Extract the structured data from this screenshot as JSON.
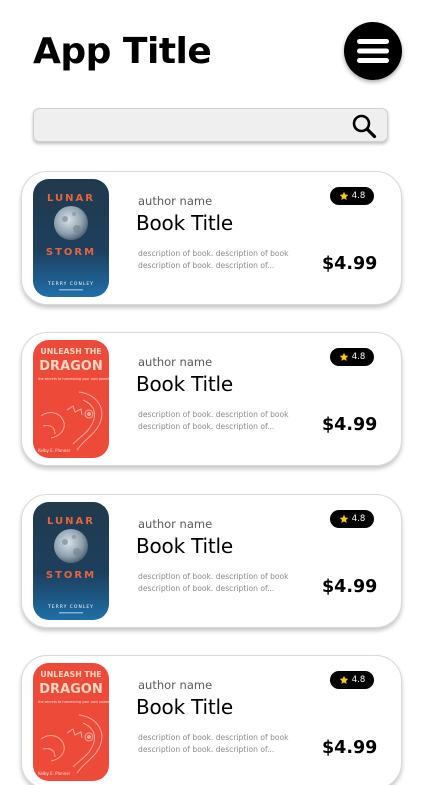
{
  "header": {
    "title": "App Title",
    "menu_icon": "hamburger-menu-icon"
  },
  "search": {
    "placeholder": "",
    "value": "",
    "icon": "search-icon"
  },
  "colors": {
    "badge": "#000000",
    "star": "#f5c518",
    "moon_cover": "#1e3b52",
    "dragon_cover": "#ee4a3a",
    "dragon_title": "#f5d9c2"
  },
  "books": [
    {
      "cover": {
        "style": "moon",
        "title_top": "LUNAR",
        "title_bottom": "STORM",
        "author": "TERRY CONLEY"
      },
      "author": "author name",
      "title": "Book Title",
      "description": "description of book. description of book description of book. description of...",
      "rating": "4.8",
      "price": "$4.99"
    },
    {
      "cover": {
        "style": "dragon",
        "title_top": "UNLEASH THE",
        "title_bottom": "DRAGON",
        "tagline": "the secrets to harnessing your own power",
        "author": "Kelby E. Planner"
      },
      "author": "author name",
      "title": "Book Title",
      "description": "description of book. description of book description of book. description of...",
      "rating": "4.8",
      "price": "$4.99"
    },
    {
      "cover": {
        "style": "moon",
        "title_top": "LUNAR",
        "title_bottom": "STORM",
        "author": "TERRY CONLEY"
      },
      "author": "author name",
      "title": "Book Title",
      "description": "description of book. description of book description of book. description of...",
      "rating": "4.8",
      "price": "$4.99"
    },
    {
      "cover": {
        "style": "dragon",
        "title_top": "UNLEASH THE",
        "title_bottom": "DRAGON",
        "tagline": "the secrets to harnessing your own power",
        "author": "Kelby E. Planner"
      },
      "author": "author name",
      "title": "Book Title",
      "description": "description of book. description of book description of book. description of...",
      "rating": "4.8",
      "price": "$4.99"
    }
  ]
}
